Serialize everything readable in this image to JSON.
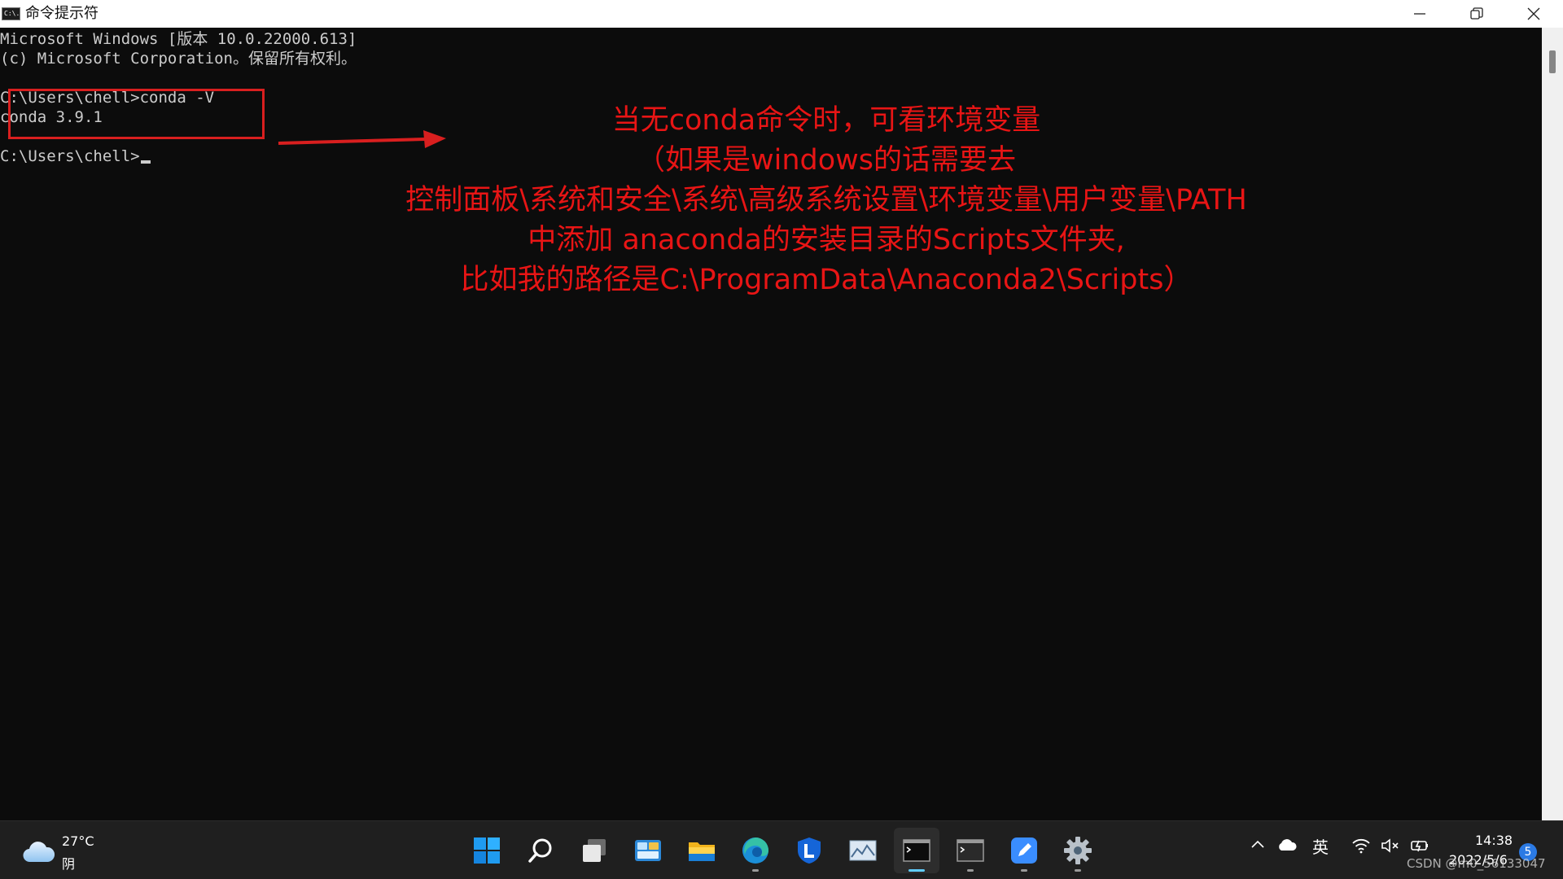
{
  "window": {
    "title": "命令提示符",
    "app_icon_text": "C:\\."
  },
  "console": {
    "lines": [
      "Microsoft Windows [版本 10.0.22000.613]",
      "(c) Microsoft Corporation。保留所有权利。",
      "C:\\Users\\chell>conda -V",
      "conda 3.9.1",
      "C:\\Users\\chell>"
    ],
    "text_color": "#cccccc",
    "background_color": "#0c0c0c"
  },
  "annotation": {
    "color": "#e81515",
    "lines": [
      "当无conda命令时，可看环境变量",
      "（如果是windows的话需要去",
      "控制面板\\系统和安全\\系统\\高级系统设置\\环境变量\\用户变量\\PATH",
      "中添加 anaconda的安装目录的Scripts文件夹,",
      "比如我的路径是C:\\ProgramData\\Anaconda2\\Scripts）"
    ]
  },
  "taskbar": {
    "weather": {
      "temperature": "27°C",
      "condition": "阴",
      "icon": "cloud-icon"
    },
    "apps": [
      {
        "name": "start",
        "icon": "windows-logo-icon",
        "running": false
      },
      {
        "name": "search",
        "icon": "search-icon",
        "running": false
      },
      {
        "name": "task-view",
        "icon": "task-view-icon",
        "running": false
      },
      {
        "name": "widgets",
        "icon": "widgets-icon",
        "running": false
      },
      {
        "name": "file-explorer",
        "icon": "folder-icon",
        "running": false
      },
      {
        "name": "edge",
        "icon": "edge-icon",
        "running": true
      },
      {
        "name": "app-l",
        "icon": "l-shield-icon",
        "running": false
      },
      {
        "name": "image-viewer",
        "icon": "image-icon",
        "running": false
      },
      {
        "name": "command-prompt",
        "icon": "terminal-icon",
        "running": true,
        "active": true
      },
      {
        "name": "terminal-2",
        "icon": "terminal-icon",
        "running": true
      },
      {
        "name": "editor",
        "icon": "pen-icon",
        "running": true
      },
      {
        "name": "settings",
        "icon": "gear-icon",
        "running": true
      }
    ],
    "tray": {
      "ime_label": "英",
      "time": "14:38",
      "date": "2022/5/6",
      "notification_count": "5",
      "icons": [
        "chevron-up-icon",
        "onedrive-cloud-icon",
        "wifi-icon",
        "volume-muted-icon",
        "battery-icon"
      ]
    }
  },
  "watermark": "CSDN @m0_56133047"
}
